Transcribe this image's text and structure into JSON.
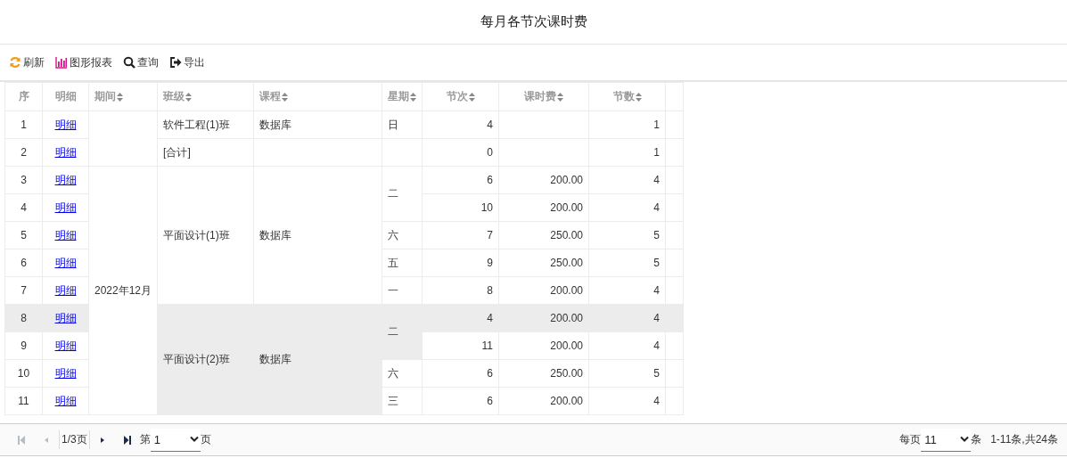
{
  "title": "每月各节次课时费",
  "toolbar": [
    {
      "kind": "refresh",
      "label": "刷新"
    },
    {
      "kind": "chart",
      "label": "图形报表"
    },
    {
      "kind": "search",
      "label": "查询"
    },
    {
      "kind": "export",
      "label": "导出"
    }
  ],
  "table": {
    "columns": [
      {
        "label": "序",
        "sortable": false
      },
      {
        "label": "明细",
        "sortable": false
      },
      {
        "label": "期间",
        "sortable": true
      },
      {
        "label": "班级",
        "sortable": true
      },
      {
        "label": "课程",
        "sortable": true
      },
      {
        "label": "星期",
        "sortable": true
      },
      {
        "label": "节次",
        "sortable": true
      },
      {
        "label": "课时费",
        "sortable": true
      },
      {
        "label": "节数",
        "sortable": true
      }
    ],
    "rows": [
      {
        "no": "1",
        "link": "明细",
        "selected": false,
        "period": {},
        "class": {
          "text": "软件工程(1)班"
        },
        "course": {
          "text": "数据库"
        },
        "weekday": {
          "text": "日"
        },
        "section": {
          "text": "4"
        },
        "fee": {},
        "count": {
          "text": "1"
        }
      },
      {
        "no": "2",
        "link": "明细",
        "selected": false,
        "class": {
          "text": "[合计]"
        },
        "course": {},
        "weekday": {},
        "section": {
          "text": "0"
        },
        "fee": {},
        "count": {
          "text": "1"
        }
      },
      {
        "no": "3",
        "link": "明细",
        "selected": false,
        "period": {
          "text": "2022年12月"
        },
        "class": {
          "text": "平面设计(1)班"
        },
        "course": {
          "text": "数据库"
        },
        "weekday": {
          "text": "二"
        },
        "section": {
          "text": "6"
        },
        "fee": {
          "text": "200.00"
        },
        "count": {
          "text": "4"
        }
      },
      {
        "no": "4",
        "link": "明细",
        "selected": false,
        "section": {
          "text": "10"
        },
        "fee": {
          "text": "200.00"
        },
        "count": {
          "text": "4"
        }
      },
      {
        "no": "5",
        "link": "明细",
        "selected": false,
        "weekday": {
          "text": "六"
        },
        "section": {
          "text": "7"
        },
        "fee": {
          "text": "250.00"
        },
        "count": {
          "text": "5"
        }
      },
      {
        "no": "6",
        "link": "明细",
        "selected": false,
        "weekday": {
          "text": "五"
        },
        "section": {
          "text": "9"
        },
        "fee": {
          "text": "250.00"
        },
        "count": {
          "text": "5"
        }
      },
      {
        "no": "7",
        "link": "明细",
        "selected": false,
        "weekday": {
          "text": "一"
        },
        "section": {
          "text": "8"
        },
        "fee": {
          "text": "200.00"
        },
        "count": {
          "text": "4"
        }
      },
      {
        "no": "8",
        "link": "明细",
        "selected": true,
        "class": {
          "text": "平面设计(2)班"
        },
        "course": {
          "text": "数据库"
        },
        "weekday": {
          "text": "二"
        },
        "section": {
          "text": "4"
        },
        "fee": {
          "text": "200.00"
        },
        "count": {
          "text": "4"
        }
      },
      {
        "no": "9",
        "link": "明细",
        "selected": false,
        "section": {
          "text": "11"
        },
        "fee": {
          "text": "200.00"
        },
        "count": {
          "text": "4"
        }
      },
      {
        "no": "10",
        "link": "明细",
        "selected": false,
        "weekday": {
          "text": "六"
        },
        "section": {
          "text": "6"
        },
        "fee": {
          "text": "250.00"
        },
        "count": {
          "text": "5"
        }
      },
      {
        "no": "11",
        "link": "明细",
        "selected": false,
        "weekday": {
          "text": "三"
        },
        "section": {
          "text": "6"
        },
        "fee": {
          "text": "200.00"
        },
        "count": {
          "text": "4"
        }
      }
    ]
  },
  "pager": {
    "first_disabled": true,
    "prev_disabled": true,
    "next_disabled": false,
    "last_disabled": false,
    "page_info": "1/3页",
    "goto_prefix": "第",
    "page": "1",
    "goto_suffix": "页",
    "per_page_prefix": "每页",
    "per_page": "11",
    "per_page_suffix": "条",
    "summary": "1-11条,共24条"
  }
}
